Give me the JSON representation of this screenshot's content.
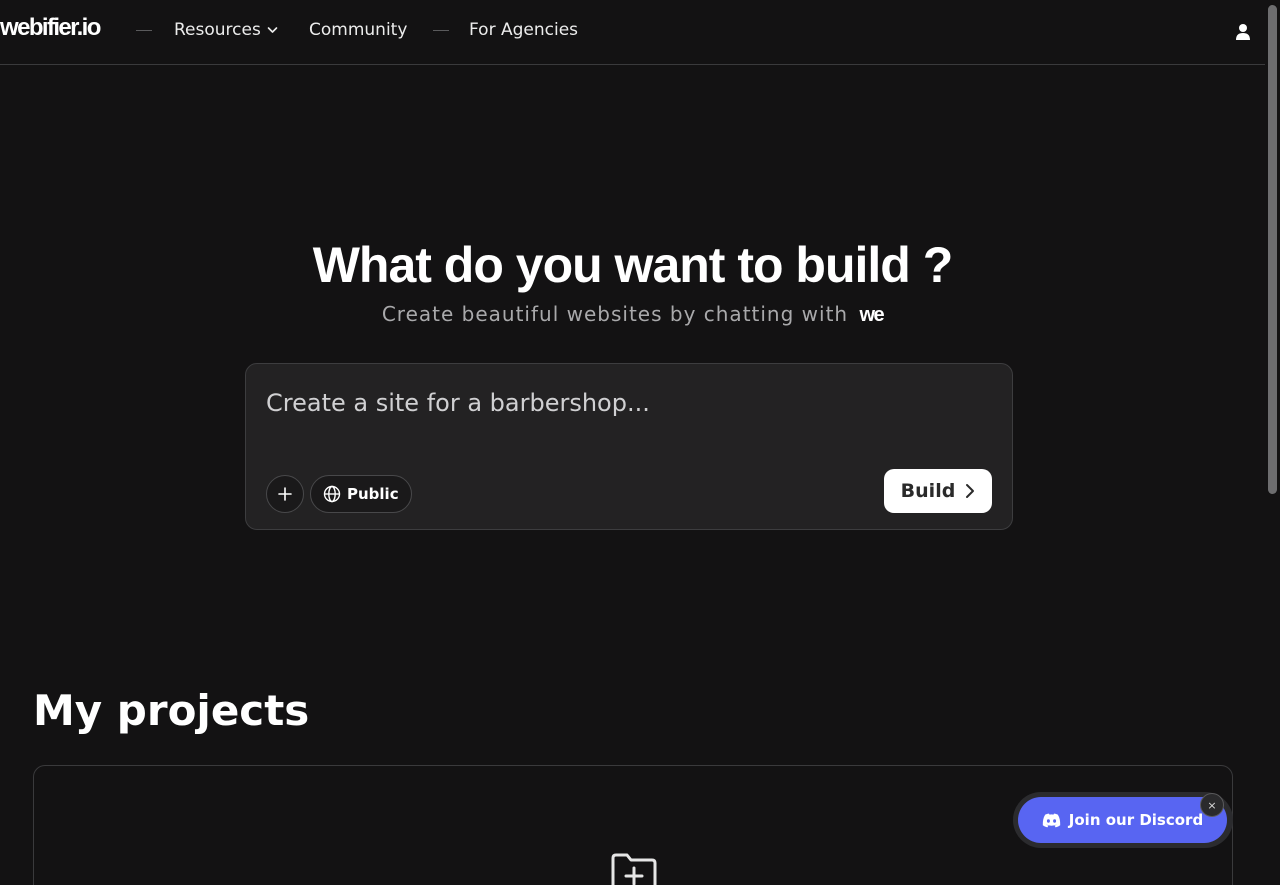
{
  "header": {
    "logo": "webifier.io",
    "nav": {
      "resources": "Resources",
      "community": "Community",
      "agencies": "For Agencies"
    },
    "user_icon": "user-icon"
  },
  "hero": {
    "title": "What do you want to build ?",
    "subtitle": "Create beautiful websites by chatting with",
    "brand_mark": "we"
  },
  "prompt": {
    "placeholder": "Create a site for a barbershop...",
    "value": "",
    "visibility_label": "Public",
    "build_label": "Build",
    "icons": [
      "plus-icon",
      "globe-icon",
      "chevron-right-icon"
    ]
  },
  "projects": {
    "title": "My projects",
    "empty_icon": "folder-plus-icon"
  },
  "discord": {
    "label": "Join our Discord",
    "close": "×",
    "icon": "discord-icon",
    "color": "#5865f2"
  },
  "colors": {
    "background": "#131213",
    "panel": "#232223",
    "accent_button": "#ffffff"
  }
}
